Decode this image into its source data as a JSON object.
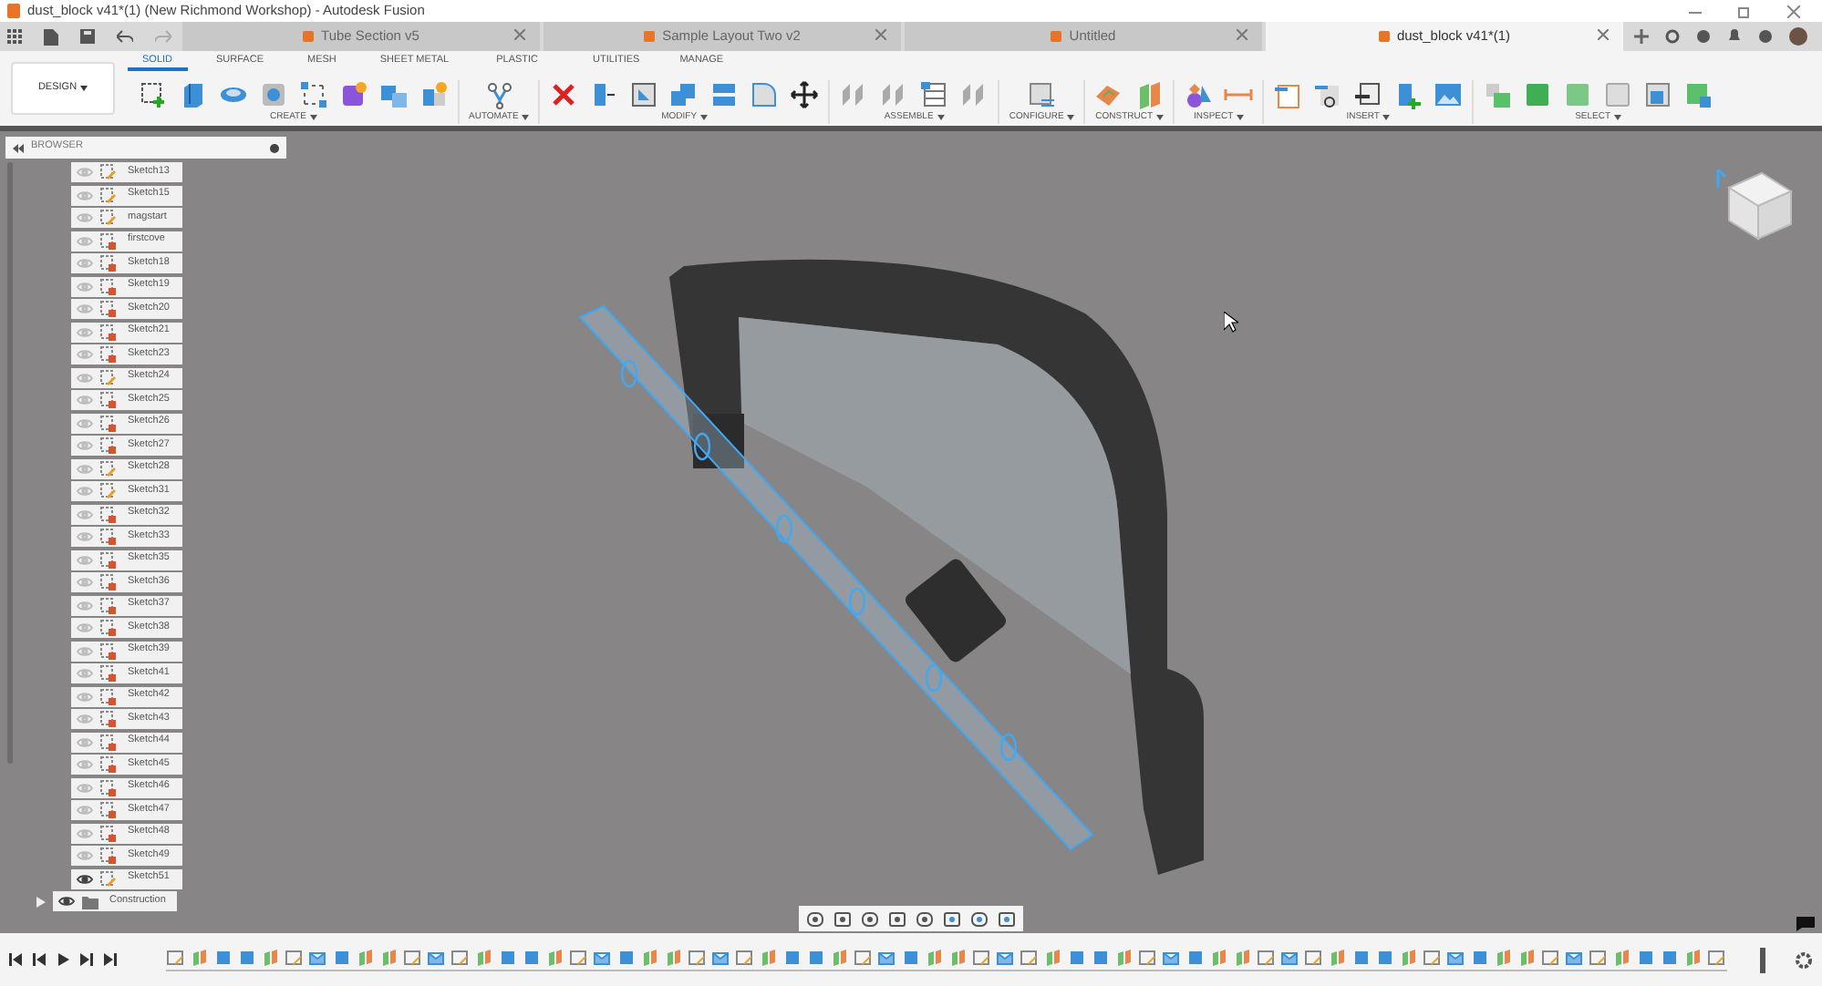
{
  "window": {
    "title": "dust_block v41*(1) (New Richmond Workshop) - Autodesk Fusion"
  },
  "document_tabs": [
    {
      "label": "Tube Section v5",
      "selected": false
    },
    {
      "label": "Sample Layout Two v2",
      "selected": false
    },
    {
      "label": "Untitled",
      "selected": false
    },
    {
      "label": "dust_block v41*(1)",
      "selected": true
    }
  ],
  "workspace": {
    "label": "DESIGN"
  },
  "ribbon_tabs": [
    {
      "label": "SOLID",
      "selected": true
    },
    {
      "label": "SURFACE",
      "selected": false
    },
    {
      "label": "MESH",
      "selected": false
    },
    {
      "label": "SHEET METAL",
      "selected": false
    },
    {
      "label": "PLASTIC",
      "selected": false
    },
    {
      "label": "UTILITIES",
      "selected": false
    },
    {
      "label": "MANAGE",
      "selected": false
    }
  ],
  "ribbon_groups": [
    "CREATE",
    "AUTOMATE",
    "MODIFY",
    "ASSEMBLE",
    "CONFIGURE",
    "CONSTRUCT",
    "INSPECT",
    "INSERT",
    "SELECT"
  ],
  "browser": {
    "title": "BROWSER",
    "items": [
      {
        "label": "Sketch13",
        "kind": "sketch",
        "visible": false
      },
      {
        "label": "Sketch15",
        "kind": "sketch",
        "visible": false
      },
      {
        "label": "magstart",
        "kind": "sketch",
        "visible": false
      },
      {
        "label": "firstcove",
        "kind": "locked-sketch",
        "visible": false
      },
      {
        "label": "Sketch18",
        "kind": "locked-sketch",
        "visible": false
      },
      {
        "label": "Sketch19",
        "kind": "locked-sketch",
        "visible": false
      },
      {
        "label": "Sketch20",
        "kind": "locked-sketch",
        "visible": false
      },
      {
        "label": "Sketch21",
        "kind": "locked-sketch",
        "visible": false
      },
      {
        "label": "Sketch23",
        "kind": "locked-sketch",
        "visible": false
      },
      {
        "label": "Sketch24",
        "kind": "sketch",
        "visible": false
      },
      {
        "label": "Sketch25",
        "kind": "locked-sketch",
        "visible": false
      },
      {
        "label": "Sketch26",
        "kind": "locked-sketch",
        "visible": false
      },
      {
        "label": "Sketch27",
        "kind": "locked-sketch",
        "visible": false
      },
      {
        "label": "Sketch28",
        "kind": "sketch",
        "visible": false
      },
      {
        "label": "Sketch31",
        "kind": "sketch",
        "visible": false
      },
      {
        "label": "Sketch32",
        "kind": "locked-sketch",
        "visible": false
      },
      {
        "label": "Sketch33",
        "kind": "locked-sketch",
        "visible": false
      },
      {
        "label": "Sketch35",
        "kind": "locked-sketch",
        "visible": false
      },
      {
        "label": "Sketch36",
        "kind": "locked-sketch",
        "visible": false
      },
      {
        "label": "Sketch37",
        "kind": "locked-sketch",
        "visible": false
      },
      {
        "label": "Sketch38",
        "kind": "locked-sketch",
        "visible": false
      },
      {
        "label": "Sketch39",
        "kind": "locked-sketch",
        "visible": false
      },
      {
        "label": "Sketch41",
        "kind": "locked-sketch",
        "visible": false
      },
      {
        "label": "Sketch42",
        "kind": "locked-sketch",
        "visible": false
      },
      {
        "label": "Sketch43",
        "kind": "locked-sketch",
        "visible": false
      },
      {
        "label": "Sketch44",
        "kind": "locked-sketch",
        "visible": false
      },
      {
        "label": "Sketch45",
        "kind": "locked-sketch",
        "visible": false
      },
      {
        "label": "Sketch46",
        "kind": "locked-sketch",
        "visible": false
      },
      {
        "label": "Sketch47",
        "kind": "locked-sketch",
        "visible": false
      },
      {
        "label": "Sketch48",
        "kind": "locked-sketch",
        "visible": false
      },
      {
        "label": "Sketch49",
        "kind": "locked-sketch",
        "visible": false
      },
      {
        "label": "Sketch51",
        "kind": "sketch",
        "visible": true
      },
      {
        "label": "Construction",
        "kind": "folder",
        "visible": true
      }
    ]
  }
}
